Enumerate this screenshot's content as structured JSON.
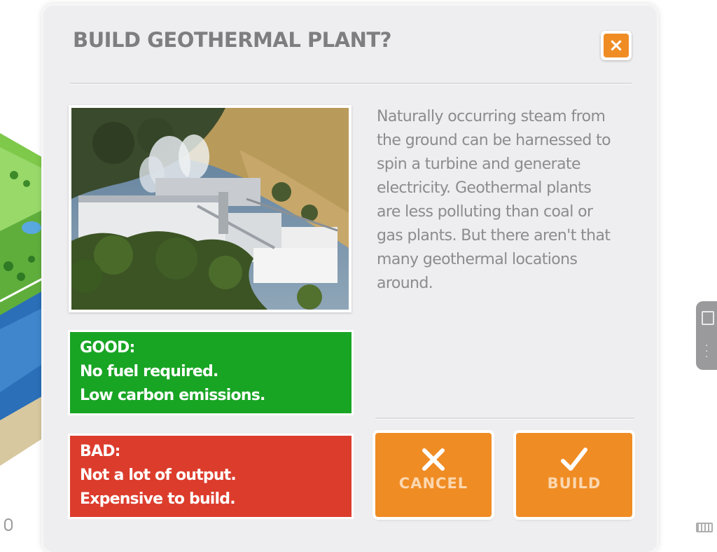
{
  "dialog": {
    "title": "BUILD GEOTHERMAL PLANT?",
    "close_icon": "×",
    "description": "Naturally occurring steam from the ground can be harnessed to spin a turbine and generate electricity. Geothermal plants are less polluting than coal or gas plants. But there aren't that many geothermal locations around.",
    "good": {
      "heading": "GOOD:",
      "lines": [
        "No fuel required.",
        "Low carbon emissions."
      ]
    },
    "bad": {
      "heading": "BAD:",
      "lines": [
        "Not a lot of output.",
        "Expensive to build."
      ]
    },
    "cancel_label": "CANCEL",
    "build_label": "BUILD"
  },
  "icons": {
    "close": "close-icon",
    "cancel": "x-icon",
    "build": "checkmark-icon",
    "side_tab": "window-icon",
    "side_tab_menu": "more-vertical-icon",
    "mouse": "mouse-icon",
    "keyboard": "keyboard-icon"
  },
  "colors": {
    "accent_orange": "#f08c24",
    "good_green": "#18a524",
    "bad_red": "#dc3c2c",
    "title_gray": "#7e7e80",
    "dialog_bg": "#eeeef0"
  }
}
